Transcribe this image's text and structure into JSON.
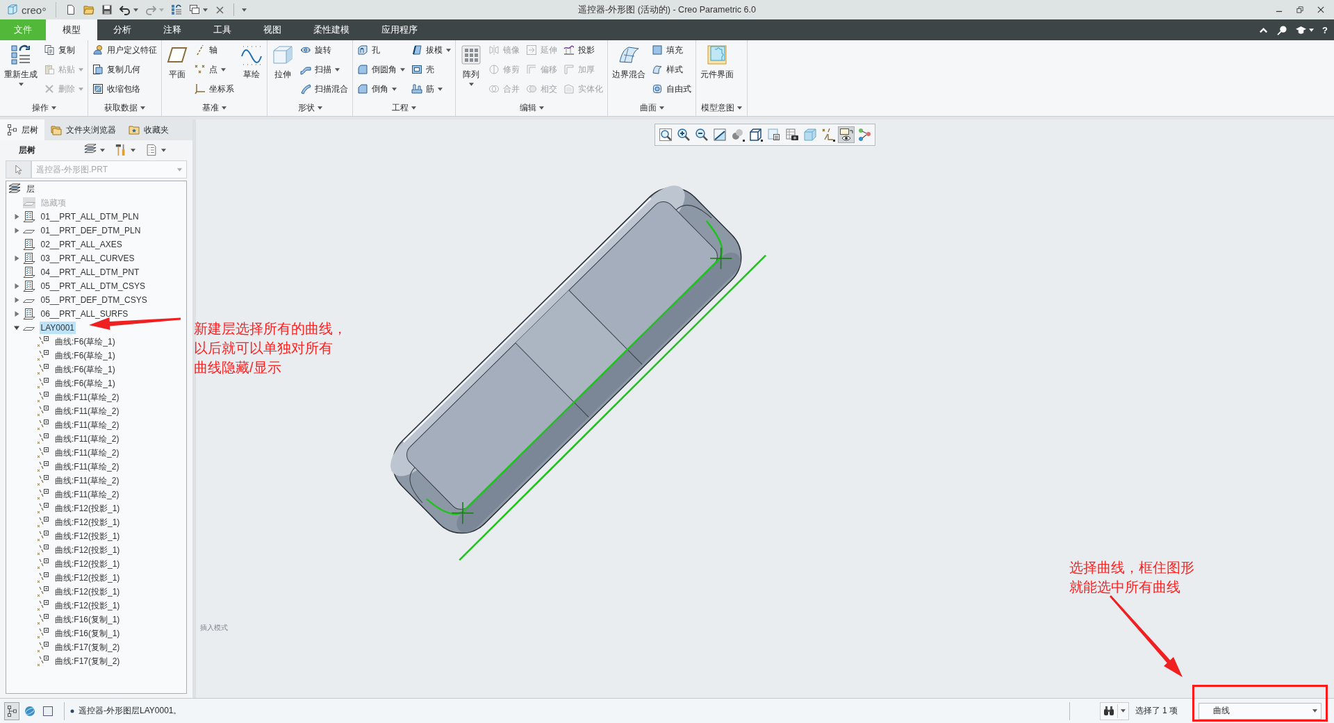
{
  "window": {
    "logo": "creo",
    "title": "遥控器-外形图 (活动的) - Creo Parametric 6.0"
  },
  "quick_access": [
    {
      "kind": "new",
      "menu": false,
      "disabled": false
    },
    {
      "kind": "open",
      "menu": false,
      "disabled": false
    },
    {
      "kind": "save",
      "menu": false,
      "disabled": false
    },
    {
      "kind": "undo",
      "menu": true,
      "disabled": false
    },
    {
      "kind": "redo",
      "menu": true,
      "disabled": true
    },
    {
      "kind": "regenerate",
      "menu": false,
      "disabled": false
    },
    {
      "kind": "windows",
      "menu": true,
      "disabled": false
    },
    {
      "kind": "close",
      "menu": false,
      "disabled": false
    },
    {
      "kind": "customize",
      "menu": true,
      "disabled": false
    }
  ],
  "ribbon": {
    "tabs": [
      {
        "label": "文件",
        "kind": "file",
        "selected": false
      },
      {
        "label": "模型",
        "kind": "tab",
        "selected": true
      },
      {
        "label": "分析",
        "kind": "tab",
        "selected": false
      },
      {
        "label": "注释",
        "kind": "tab",
        "selected": false
      },
      {
        "label": "工具",
        "kind": "tab",
        "selected": false
      },
      {
        "label": "视图",
        "kind": "tab",
        "selected": false
      },
      {
        "label": "柔性建模",
        "kind": "tab",
        "selected": false
      },
      {
        "label": "应用程序",
        "kind": "tab",
        "selected": false
      }
    ],
    "tools": [
      {
        "kind": "collapse",
        "menu": false
      },
      {
        "kind": "search",
        "menu": false
      },
      {
        "kind": "learning",
        "menu": true
      },
      {
        "kind": "help",
        "label": "?",
        "menu": false
      }
    ],
    "groups": [
      {
        "label": "操作",
        "columns": [
          {
            "kind": "large",
            "items": [
              {
                "label": "重新生成",
                "kind": "regenerate",
                "menu": true,
                "disabled": false
              }
            ]
          },
          {
            "kind": "small",
            "items": [
              {
                "label": "复制",
                "kind": "copy",
                "menu": false,
                "disabled": false
              },
              {
                "label": "粘贴",
                "kind": "paste",
                "menu": true,
                "disabled": true
              },
              {
                "label": "删除",
                "kind": "delete",
                "menu": true,
                "disabled": true
              }
            ]
          }
        ]
      },
      {
        "label": "获取数据",
        "columns": [
          {
            "kind": "small",
            "items": [
              {
                "label": "用户定义特征",
                "kind": "udf",
                "menu": false,
                "disabled": false
              },
              {
                "label": "复制几何",
                "kind": "copygeom",
                "menu": false,
                "disabled": false
              },
              {
                "label": "收缩包络",
                "kind": "shrinkwrap",
                "menu": false,
                "disabled": false
              }
            ]
          }
        ]
      },
      {
        "label": "基准",
        "columns": [
          {
            "kind": "large",
            "items": [
              {
                "label": "平面",
                "kind": "plane",
                "menu": false,
                "disabled": false
              }
            ]
          },
          {
            "kind": "small",
            "items": [
              {
                "label": "轴",
                "kind": "axis",
                "menu": false,
                "disabled": false
              },
              {
                "label": "点",
                "kind": "point",
                "menu": true,
                "disabled": false
              },
              {
                "label": "坐标系",
                "kind": "csys",
                "menu": false,
                "disabled": false
              }
            ]
          },
          {
            "kind": "large",
            "items": [
              {
                "label": "草绘",
                "kind": "sketch",
                "menu": false,
                "disabled": false
              }
            ]
          }
        ]
      },
      {
        "label": "形状",
        "columns": [
          {
            "kind": "large",
            "items": [
              {
                "label": "拉伸",
                "kind": "extrude",
                "menu": false,
                "disabled": false
              }
            ]
          },
          {
            "kind": "small",
            "items": [
              {
                "label": "旋转",
                "kind": "revolve",
                "menu": false,
                "disabled": false
              },
              {
                "label": "扫描",
                "kind": "sweep",
                "menu": true,
                "disabled": false
              },
              {
                "label": "扫描混合",
                "kind": "sweptblend",
                "menu": false,
                "disabled": false
              }
            ]
          }
        ]
      },
      {
        "label": "工程",
        "columns": [
          {
            "kind": "small",
            "items": [
              {
                "label": "孔",
                "kind": "hole",
                "menu": false,
                "disabled": false
              },
              {
                "label": "倒圆角",
                "kind": "round",
                "menu": true,
                "disabled": false
              },
              {
                "label": "倒角",
                "kind": "chamfer",
                "menu": true,
                "disabled": false
              }
            ]
          },
          {
            "kind": "small",
            "items": [
              {
                "label": "拔模",
                "kind": "draft",
                "menu": true,
                "disabled": false
              },
              {
                "label": "壳",
                "kind": "shell",
                "menu": false,
                "disabled": false
              },
              {
                "label": "筋",
                "kind": "rib",
                "menu": true,
                "disabled": false
              }
            ]
          }
        ]
      },
      {
        "label": "编辑",
        "columns": [
          {
            "kind": "large",
            "items": [
              {
                "label": "阵列",
                "kind": "pattern",
                "menu": true,
                "disabled": false
              }
            ]
          },
          {
            "kind": "small",
            "items": [
              {
                "label": "镜像",
                "kind": "mirror",
                "menu": false,
                "disabled": true
              },
              {
                "label": "修剪",
                "kind": "trim",
                "menu": false,
                "disabled": true
              },
              {
                "label": "合并",
                "kind": "merge",
                "menu": false,
                "disabled": true
              }
            ]
          },
          {
            "kind": "small",
            "items": [
              {
                "label": "延伸",
                "kind": "extend",
                "menu": false,
                "disabled": true
              },
              {
                "label": "偏移",
                "kind": "offset",
                "menu": false,
                "disabled": true
              },
              {
                "label": "相交",
                "kind": "intersect",
                "menu": false,
                "disabled": true
              }
            ]
          },
          {
            "kind": "small",
            "items": [
              {
                "label": "投影",
                "kind": "project",
                "menu": false,
                "disabled": false
              },
              {
                "label": "加厚",
                "kind": "thicken",
                "menu": false,
                "disabled": true
              },
              {
                "label": "实体化",
                "kind": "solidify",
                "menu": false,
                "disabled": true
              }
            ]
          }
        ]
      },
      {
        "label": "曲面",
        "columns": [
          {
            "kind": "large",
            "items": [
              {
                "label": "边界混合",
                "kind": "boundary",
                "menu": false,
                "disabled": false
              }
            ]
          },
          {
            "kind": "small",
            "items": [
              {
                "label": "填充",
                "kind": "fill",
                "menu": false,
                "disabled": false
              },
              {
                "label": "样式",
                "kind": "style",
                "menu": false,
                "disabled": false
              },
              {
                "label": "自由式",
                "kind": "freestyle",
                "menu": false,
                "disabled": false
              }
            ]
          }
        ]
      },
      {
        "label": "模型意图",
        "columns": [
          {
            "kind": "large",
            "items": [
              {
                "label": "元件界面",
                "kind": "interface",
                "menu": false,
                "disabled": false
              }
            ]
          }
        ]
      }
    ]
  },
  "layer_tree": {
    "tabs": [
      {
        "label": "层树",
        "kind": "tree",
        "selected": true
      },
      {
        "label": "文件夹浏览器",
        "kind": "folder",
        "selected": false
      },
      {
        "label": "收藏夹",
        "kind": "favorites",
        "selected": false
      }
    ],
    "header": {
      "title": "层树",
      "tools": [
        {
          "kind": "layers",
          "menu": true
        },
        {
          "kind": "settings",
          "menu": true
        },
        {
          "kind": "show",
          "menu": true
        }
      ]
    },
    "model_select": {
      "value": "遥控器-外形图.PRT",
      "disabled": true
    },
    "root": {
      "label": "层",
      "kind": "root",
      "selected": false,
      "children": [
        {
          "label": "隐藏项",
          "kind": "hidden",
          "selected": false
        },
        {
          "label": "01__PRT_ALL_DTM_PLN",
          "kind": "rule",
          "expanded": false,
          "selected": false
        },
        {
          "label": "01__PRT_DEF_DTM_PLN",
          "kind": "plain",
          "expanded": false,
          "selected": false
        },
        {
          "label": "02__PRT_ALL_AXES",
          "kind": "rule",
          "selected": false
        },
        {
          "label": "03__PRT_ALL_CURVES",
          "kind": "rule",
          "expanded": false,
          "selected": false
        },
        {
          "label": "04__PRT_ALL_DTM_PNT",
          "kind": "rule",
          "selected": false
        },
        {
          "label": "05__PRT_ALL_DTM_CSYS",
          "kind": "rule",
          "expanded": false,
          "selected": false
        },
        {
          "label": "05__PRT_DEF_DTM_CSYS",
          "kind": "plain",
          "expanded": false,
          "selected": false
        },
        {
          "label": "06__PRT_ALL_SURFS",
          "kind": "rule",
          "expanded": false,
          "selected": false
        },
        {
          "label": "LAY0001",
          "kind": "plain",
          "expanded": true,
          "selected": true,
          "children": [
            {
              "label": "曲线:F6(草绘_1)",
              "kind": "curve",
              "selected": false
            },
            {
              "label": "曲线:F6(草绘_1)",
              "kind": "curve",
              "selected": false
            },
            {
              "label": "曲线:F6(草绘_1)",
              "kind": "curve",
              "selected": false
            },
            {
              "label": "曲线:F6(草绘_1)",
              "kind": "curve",
              "selected": false
            },
            {
              "label": "曲线:F11(草绘_2)",
              "kind": "curve",
              "selected": false
            },
            {
              "label": "曲线:F11(草绘_2)",
              "kind": "curve",
              "selected": false
            },
            {
              "label": "曲线:F11(草绘_2)",
              "kind": "curve",
              "selected": false
            },
            {
              "label": "曲线:F11(草绘_2)",
              "kind": "curve",
              "selected": false
            },
            {
              "label": "曲线:F11(草绘_2)",
              "kind": "curve",
              "selected": false
            },
            {
              "label": "曲线:F11(草绘_2)",
              "kind": "curve",
              "selected": false
            },
            {
              "label": "曲线:F11(草绘_2)",
              "kind": "curve",
              "selected": false
            },
            {
              "label": "曲线:F11(草绘_2)",
              "kind": "curve",
              "selected": false
            },
            {
              "label": "曲线:F12(投影_1)",
              "kind": "curve",
              "selected": false
            },
            {
              "label": "曲线:F12(投影_1)",
              "kind": "curve",
              "selected": false
            },
            {
              "label": "曲线:F12(投影_1)",
              "kind": "curve",
              "selected": false
            },
            {
              "label": "曲线:F12(投影_1)",
              "kind": "curve",
              "selected": false
            },
            {
              "label": "曲线:F12(投影_1)",
              "kind": "curve",
              "selected": false
            },
            {
              "label": "曲线:F12(投影_1)",
              "kind": "curve",
              "selected": false
            },
            {
              "label": "曲线:F12(投影_1)",
              "kind": "curve",
              "selected": false
            },
            {
              "label": "曲线:F12(投影_1)",
              "kind": "curve",
              "selected": false
            },
            {
              "label": "曲线:F16(复制_1)",
              "kind": "curve",
              "selected": false
            },
            {
              "label": "曲线:F16(复制_1)",
              "kind": "curve",
              "selected": false
            },
            {
              "label": "曲线:F17(复制_2)",
              "kind": "curve",
              "selected": false
            },
            {
              "label": "曲线:F17(复制_2)",
              "kind": "curve",
              "selected": false
            }
          ]
        }
      ]
    }
  },
  "view_toolbar": [
    {
      "kind": "refit",
      "selected": false
    },
    {
      "kind": "zoomin",
      "selected": false
    },
    {
      "kind": "zoomout",
      "selected": false
    },
    {
      "kind": "repaint",
      "selected": false
    },
    {
      "kind": "display",
      "selected": false
    },
    {
      "kind": "saved",
      "selected": false
    },
    {
      "kind": "manager",
      "selected": false
    },
    {
      "kind": "camera",
      "selected": false
    },
    {
      "kind": "perspective",
      "selected": false
    },
    {
      "kind": "datum",
      "selected": false
    },
    {
      "kind": "filter",
      "selected": true
    },
    {
      "kind": "spin",
      "selected": false
    }
  ],
  "graphics": {
    "mode_text": "插入模式"
  },
  "annotations": [
    {
      "lines": [
        "新建层选择所有的曲线，",
        "以后就可以单独对所有",
        "曲线隐藏/显示"
      ]
    },
    {
      "lines": [
        "选择曲线，框住图形",
        "就能选中所有曲线"
      ]
    }
  ],
  "status_bar": {
    "buttons": [
      {
        "kind": "tree",
        "selected": true
      },
      {
        "kind": "browser",
        "selected": false
      },
      {
        "kind": "window",
        "selected": false
      }
    ],
    "message": "遥控器-外形图层LAY0001。",
    "selection": "选择了 1 项",
    "filter": {
      "value": "曲线"
    }
  }
}
